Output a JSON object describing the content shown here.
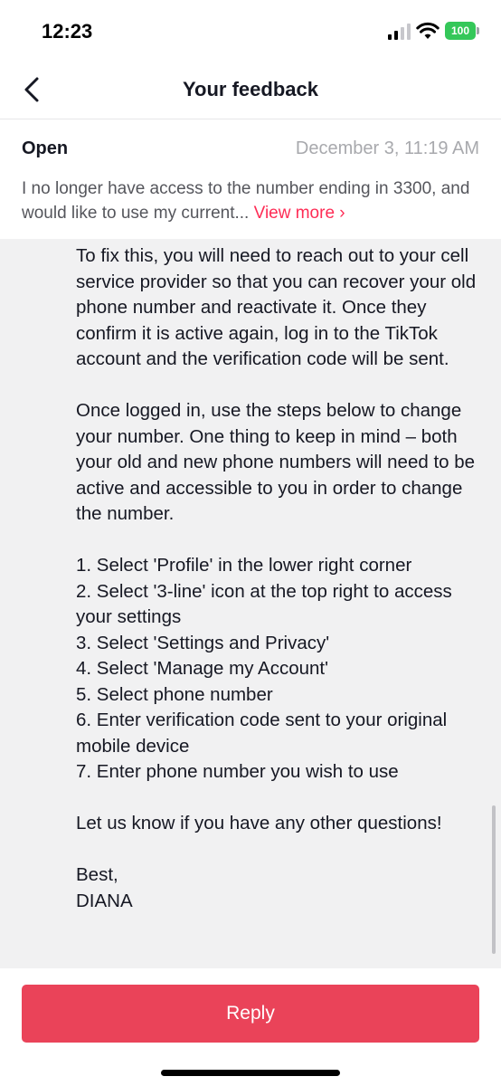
{
  "status_bar": {
    "time": "12:23",
    "battery": "100",
    "icons": [
      "signal-icon",
      "wifi-icon",
      "battery-icon"
    ]
  },
  "nav": {
    "title": "Your feedback",
    "back_icon": "chevron-left-icon"
  },
  "ticket": {
    "status": "Open",
    "date": "December 3, 11:19 AM",
    "summary": "I no longer have access to the number ending in 3300, and would like to use my current...",
    "view_more": "View more ›"
  },
  "message": {
    "paragraphs": [
      "To fix this, you will need to reach out to your cell service provider so that you can recover your old phone number and reactivate it. Once they confirm it is active again, log in to the TikTok account and the verification code will be sent.",
      "Once logged in, use the steps below to change your number. One thing to keep in mind – both your old and new phone numbers will need to be active and accessible to you in order to change the number."
    ],
    "steps": [
      "1. Select 'Profile' in the lower right corner",
      "2. Select '3-line' icon at the top right to access your settings",
      "3. Select 'Settings and Privacy'",
      "4. Select 'Manage my Account'",
      "5. Select phone number",
      "6. Enter verification code sent to your original mobile device",
      "7. Enter phone number you wish to use"
    ],
    "closing": "Let us know if you have any other questions!",
    "signoff": "Best,",
    "signature": "DIANA"
  },
  "actions": {
    "reply_label": "Reply"
  },
  "colors": {
    "accent": "#fe2c55",
    "reply_button": "#ea4359",
    "battery": "#34c759",
    "message_bg": "#f1f1f2"
  }
}
